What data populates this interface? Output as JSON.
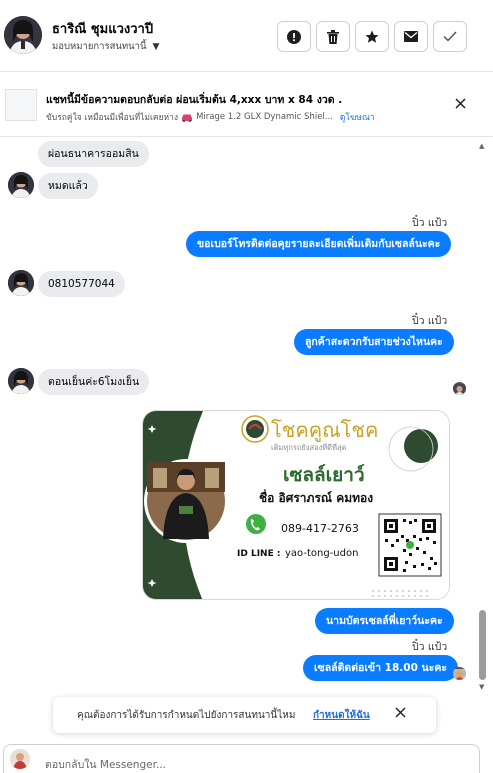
{
  "header": {
    "contact_name": "ธาริณี ชุมแวงวาปี",
    "assign_label": "มอบหมายการสนทนานี้",
    "actions": [
      "alert-icon",
      "trash-icon",
      "star-icon",
      "mail-icon",
      "check-icon"
    ]
  },
  "ad": {
    "title": "แชทนี้มีข้อความตอบกลับต่อ ผ่อนเริ่มต้น 4,xxx บาท x 84 งวด .",
    "subtitle": "ขับรถคู่ใจ เหมือนมีเพื่อนที่ไม่เคยห่าง",
    "product": "Mirage 1.2 GLX Dynamic Shiel...",
    "view_link": "ดูโฆษณา"
  },
  "messages": {
    "m1": "ผ่อนธนาคารออมสิน",
    "m2": "หมดแล้ว",
    "sender1": "ปิ๋ว แป้ว",
    "m3": "ขอเบอร์โทรติดต่อคุยรายละเอียดเพิ่มเติมกับเซลล์นะคะ",
    "m4": "0810577044",
    "sender2": "ปิ๋ว แป้ว",
    "m5": "ลูกค้าสะดวกรับสายช่วงไหนคะ",
    "m6": "ตอนเย็นค่ะ6โมงเย็น",
    "m7": "นามบัตรเซลล์พี่เยาว์นะคะ",
    "sender3": "ปิ๋ว แป้ว",
    "m8": "เซลล์ติดต่อเข้า 18.00  นะคะ"
  },
  "card": {
    "brand": "โชคคูณโชค",
    "tagline": "เติมทุกรถยังสองที่ดีที่สุด",
    "seller_nick": "เซลล์เยาว์",
    "seller_name": "ชื่อ อิศราภรณ์  คมทอง",
    "phone": "089-417-2763",
    "line_label": "ID LINE :",
    "line_id": "yao-tong-udon",
    "colors": {
      "green": "#2e4a2f",
      "accent": "#3cb043",
      "brand": "#c9a227"
    }
  },
  "toast": {
    "message": "คุณต้องการได้รับการกำหนดไปยังการสนทนานี้ไหม",
    "action": "กำหนดให้ฉัน"
  },
  "composer": {
    "placeholder": "ตอบกลับใน Messenger..."
  }
}
